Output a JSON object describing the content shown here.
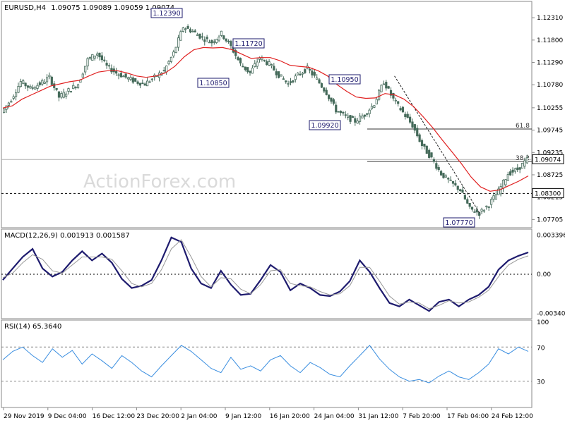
{
  "header": {
    "symbol": "EURUSD,H4",
    "ohlc": "1.09075 1.09089 1.09059 1.09074"
  },
  "watermark": "ActionForex.com",
  "colors": {
    "price": "#456a5a",
    "ma": "#e02020",
    "macd": "#1e1b6e",
    "signal": "#999999",
    "rsi": "#3a8ee0",
    "label_border": "#1e1b6e",
    "fib": "#333333"
  },
  "chart_data": [
    {
      "type": "line",
      "name": "price-panel",
      "ylim": [
        1.0755,
        1.1265
      ],
      "y_ticks": [
        "1.12310",
        "1.11800",
        "1.11290",
        "1.10780",
        "1.10255",
        "1.09745",
        "1.09235",
        "1.08725",
        "1.08215",
        "1.07705"
      ],
      "current_price_label": "1.09074",
      "support_label": "1.08300",
      "fib_labels": [
        "61.8",
        "38.2"
      ],
      "annotations": [
        "1.12390",
        "1.11720",
        "1.10850",
        "1.10950",
        "1.09920",
        "1.07770"
      ],
      "x_labels": [
        "29 Nov 2019",
        "9 Dec 04:00",
        "16 Dec 12:00",
        "23 Dec 20:00",
        "2 Jan 04:00",
        "9 Jan 12:00",
        "16 Jan 20:00",
        "24 Jan 04:00",
        "31 Jan 12:00",
        "7 Feb 20:00",
        "17 Feb 04:00",
        "24 Feb 12:00"
      ],
      "series": [
        {
          "values": [
            1.1015,
            1.1045,
            1.1085,
            1.107,
            1.108,
            1.1095,
            1.105,
            1.1065,
            1.108,
            1.1135,
            1.115,
            1.112,
            1.1105,
            1.1095,
            1.1085,
            1.108,
            1.1095,
            1.111,
            1.115,
            1.121,
            1.12,
            1.1185,
            1.1175,
            1.1195,
            1.1165,
            1.1125,
            1.1105,
            1.114,
            1.1125,
            1.11,
            1.108,
            1.11,
            1.1115,
            1.109,
            1.106,
            1.102,
            1.1005,
            1.0995,
            1.101,
            1.1035,
            1.1085,
            1.1045,
            1.1015,
            1.0985,
            1.094,
            1.091,
            1.0875,
            1.0855,
            1.0838,
            1.0795,
            1.0785,
            1.0805,
            1.0835,
            1.0875,
            1.0885,
            1.0907
          ]
        },
        {
          "values": [
            1.1025,
            1.103,
            1.1045,
            1.1055,
            1.1065,
            1.1075,
            1.108,
            1.1085,
            1.1088,
            1.1098,
            1.1107,
            1.111,
            1.111,
            1.1105,
            1.1098,
            1.1095,
            1.1098,
            1.1105,
            1.112,
            1.1142,
            1.1158,
            1.1163,
            1.1162,
            1.1163,
            1.1158,
            1.1148,
            1.1138,
            1.114,
            1.114,
            1.1133,
            1.1123,
            1.112,
            1.1118,
            1.111,
            1.1098,
            1.1078,
            1.1063,
            1.105,
            1.1047,
            1.1048,
            1.1058,
            1.1055,
            1.1045,
            1.1028,
            1.1005,
            1.098,
            1.0952,
            1.0925,
            1.0898,
            1.0868,
            1.0845,
            1.0835,
            1.0838,
            1.0848,
            1.0858,
            1.087
          ]
        }
      ],
      "fib_levels": [
        1.0977,
        1.0903
      ],
      "support_level": 1.083
    },
    {
      "type": "line",
      "name": "macd-panel",
      "title": "MACD(12,26,9) 0.001913 0.001587",
      "ylim": [
        -0.0038,
        0.0038
      ],
      "y_ticks": [
        "0.003396",
        "0.00",
        "-0.003404"
      ],
      "series": [
        {
          "name": "MACD",
          "values": [
            -0.0005,
            0.0005,
            0.0015,
            0.0022,
            0.0005,
            -0.0002,
            0.0002,
            0.0012,
            0.002,
            0.0012,
            0.0018,
            0.001,
            -0.0004,
            -0.0012,
            -0.001,
            -0.0005,
            0.0012,
            0.0032,
            0.0028,
            0.0005,
            -0.0008,
            -0.0012,
            0.0003,
            -0.0009,
            -0.0018,
            -0.0017,
            -0.0005,
            0.0008,
            0.0002,
            -0.0014,
            -0.0008,
            -0.0012,
            -0.0018,
            -0.0019,
            -0.0015,
            -0.0006,
            0.0012,
            0.0002,
            -0.0012,
            -0.0025,
            -0.0028,
            -0.0022,
            -0.0027,
            -0.0032,
            -0.0024,
            -0.0022,
            -0.0028,
            -0.0022,
            -0.0018,
            -0.0011,
            0.0004,
            0.0012,
            0.0016,
            0.0019
          ]
        },
        {
          "name": "Signal",
          "values": [
            -0.0003,
            0.0001,
            0.001,
            0.0017,
            0.0013,
            0.0003,
            0.0001,
            0.0008,
            0.0015,
            0.0015,
            0.0015,
            0.0013,
            0.0003,
            -0.0008,
            -0.0011,
            -0.0008,
            0.0004,
            0.0022,
            0.003,
            0.0015,
            -0.0002,
            -0.0011,
            -0.0003,
            -0.0004,
            -0.0013,
            -0.0017,
            -0.0009,
            0.0003,
            0.0004,
            -0.0008,
            -0.001,
            -0.0011,
            -0.0015,
            -0.0018,
            -0.0017,
            -0.001,
            0.0006,
            0.0006,
            -0.0006,
            -0.0019,
            -0.0026,
            -0.0024,
            -0.0025,
            -0.003,
            -0.0027,
            -0.0023,
            -0.0025,
            -0.0024,
            -0.002,
            -0.0014,
            -0.0002,
            0.0008,
            0.0013,
            0.0016
          ]
        }
      ]
    },
    {
      "type": "line",
      "name": "rsi-panel",
      "title": "RSI(14) 65.3640",
      "ylim": [
        0,
        100
      ],
      "y_ticks": [
        "100",
        "70",
        "30",
        "0"
      ],
      "levels": [
        70,
        30
      ],
      "series": [
        {
          "name": "RSI",
          "values": [
            55,
            65,
            70,
            60,
            52,
            68,
            58,
            66,
            50,
            62,
            54,
            45,
            60,
            52,
            42,
            35,
            48,
            60,
            72,
            65,
            55,
            45,
            40,
            58,
            44,
            48,
            42,
            55,
            60,
            48,
            40,
            52,
            46,
            38,
            35,
            48,
            60,
            72,
            56,
            44,
            35,
            30,
            32,
            28,
            36,
            42,
            35,
            32,
            40,
            50,
            68,
            62,
            70,
            65
          ]
        }
      ]
    }
  ]
}
